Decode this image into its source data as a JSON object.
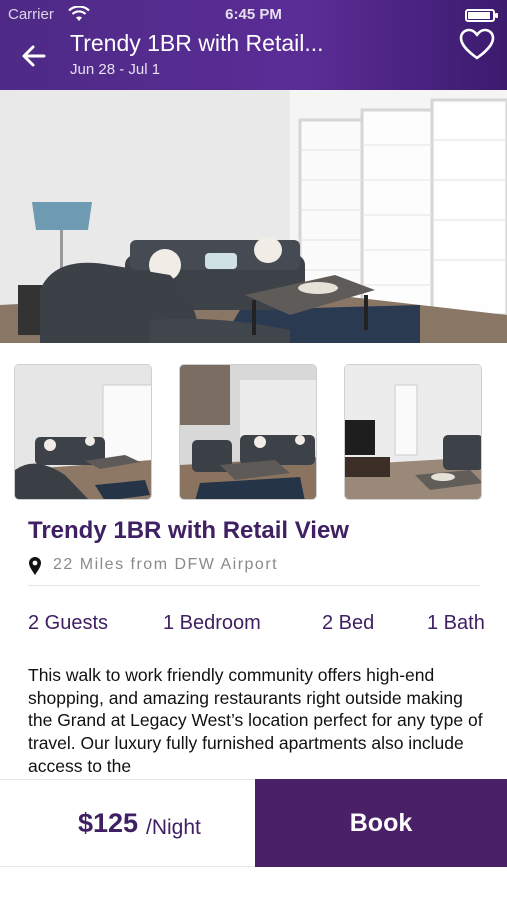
{
  "status_bar": {
    "carrier": "Carrier",
    "time": "6:45 PM",
    "wifi_icon": "wifi-icon",
    "battery_icon": "battery-icon"
  },
  "header": {
    "title": "Trendy 1BR with Retail...",
    "dates": "Jun 28 - Jul 1",
    "back_icon": "arrow-left-icon",
    "favorite_icon": "heart-outline-icon",
    "background_color": "#4e2a86"
  },
  "listing": {
    "name": "Trendy 1BR with Retail View",
    "location": "22 Miles from DFW Airport",
    "location_icon": "map-pin-icon",
    "amenities": [
      "2 Guests",
      "1 Bedroom",
      "2 Bed",
      "1 Bath"
    ],
    "description": " This walk to work friendly community offers high-end shopping, and amazing restaurants right outside making the Grand at Legacy West’s location perfect for any type of travel. Our luxury fully furnished apartments also include access to the"
  },
  "booking": {
    "price": "$125",
    "price_unit": "/Night",
    "book_label": "Book",
    "accent_color": "#4a2066"
  }
}
